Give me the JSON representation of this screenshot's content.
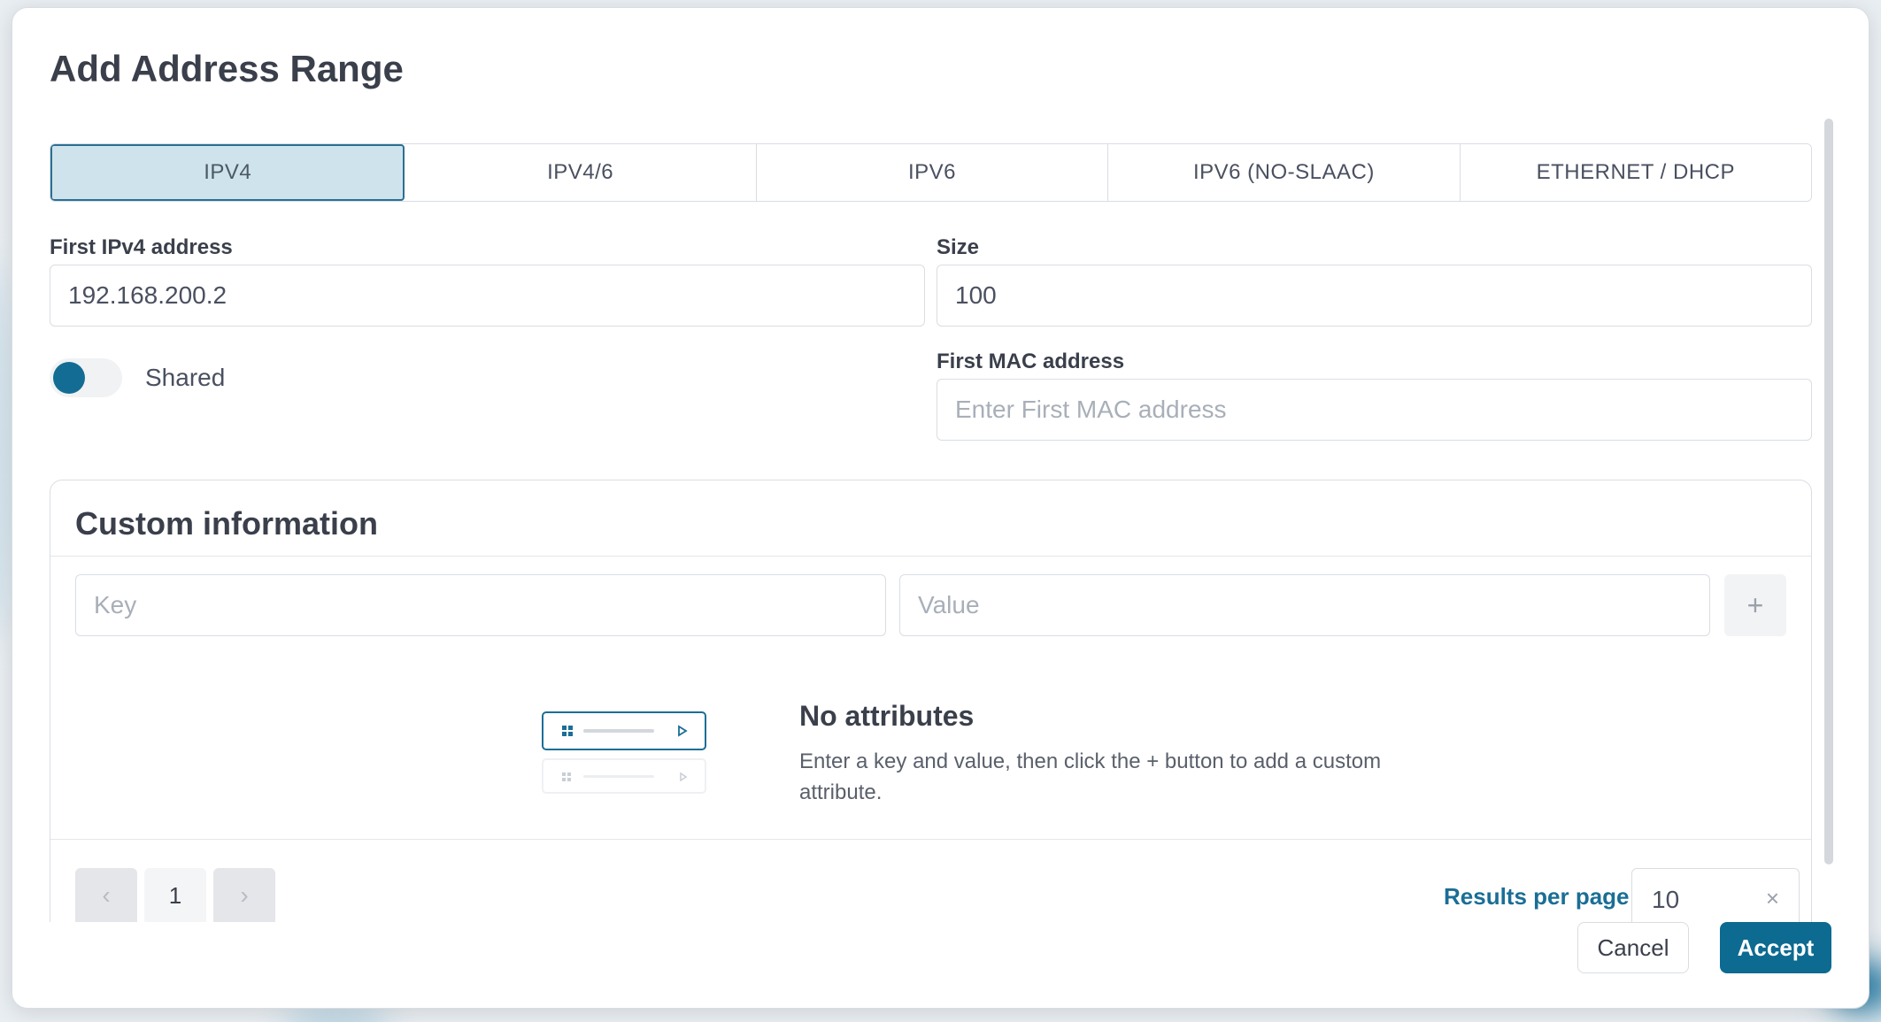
{
  "dialog": {
    "title": "Add Address Range"
  },
  "tabs": [
    {
      "label": "IPV4",
      "active": true
    },
    {
      "label": "IPV4/6",
      "active": false
    },
    {
      "label": "IPV6",
      "active": false
    },
    {
      "label": "IPV6 (NO-SLAAC)",
      "active": false
    },
    {
      "label": "ETHERNET / DHCP",
      "active": false
    }
  ],
  "form": {
    "first_ipv4": {
      "label": "First IPv4 address",
      "value": "192.168.200.2"
    },
    "size": {
      "label": "Size",
      "value": "100"
    },
    "shared_toggle": {
      "label": "Shared",
      "on": false
    },
    "first_mac": {
      "label": "First MAC address",
      "placeholder": "Enter First MAC address"
    }
  },
  "custom_info": {
    "title": "Custom information",
    "key_placeholder": "Key",
    "value_placeholder": "Value",
    "add_label": "+",
    "empty_title": "No attributes",
    "empty_desc": "Enter a key and value, then click the + button to add a custom attribute."
  },
  "pagination": {
    "prev": "‹",
    "current_page": "1",
    "next": "›",
    "results_label": "Results per page",
    "results_value": "10",
    "clear": "×"
  },
  "footer": {
    "cancel": "Cancel",
    "accept": "Accept"
  },
  "colors": {
    "accent": "#0d6a91",
    "tab_active_bg": "#cfe3ec",
    "link": "#1a6e96"
  }
}
